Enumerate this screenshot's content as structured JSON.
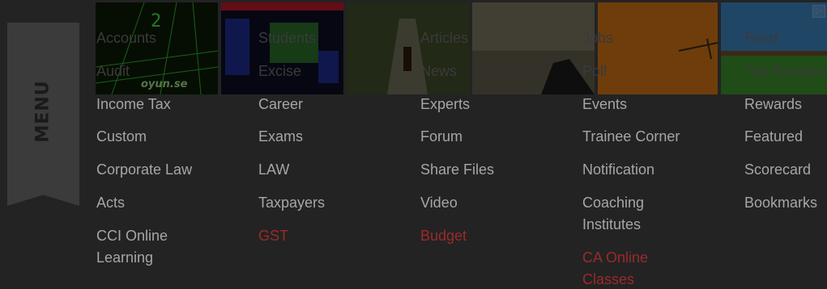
{
  "menu": {
    "label": "MENU"
  },
  "ad": {
    "brand_text": "oyun.se",
    "adchoice_icon": "ad-choices-icon"
  },
  "columns": [
    {
      "items": [
        {
          "label": "Accounts",
          "style": "over"
        },
        {
          "label": "Audit",
          "style": "over"
        },
        {
          "label": "Income Tax",
          "style": "normal"
        },
        {
          "label": "Custom",
          "style": "normal"
        },
        {
          "label": "Corporate Law",
          "style": "normal"
        },
        {
          "label": "Acts",
          "style": "normal"
        },
        {
          "label": "CCI Online Learning",
          "style": "normal"
        }
      ]
    },
    {
      "items": [
        {
          "label": "Students",
          "style": "over"
        },
        {
          "label": "Excise",
          "style": "over"
        },
        {
          "label": "Career",
          "style": "normal"
        },
        {
          "label": "Exams",
          "style": "normal"
        },
        {
          "label": "LAW",
          "style": "normal"
        },
        {
          "label": "Taxpayers",
          "style": "normal"
        },
        {
          "label": "GST",
          "style": "red"
        }
      ]
    },
    {
      "items": [
        {
          "label": "Articles",
          "style": "over"
        },
        {
          "label": "News",
          "style": "over"
        },
        {
          "label": "Experts",
          "style": "normal"
        },
        {
          "label": "Forum",
          "style": "normal"
        },
        {
          "label": "Share Files",
          "style": "normal"
        },
        {
          "label": "Video",
          "style": "normal"
        },
        {
          "label": "Budget",
          "style": "red"
        }
      ]
    },
    {
      "items": [
        {
          "label": "Jobs",
          "style": "over"
        },
        {
          "label": "Poll",
          "style": "over"
        },
        {
          "label": "Events",
          "style": "normal"
        },
        {
          "label": "Trainee Corner",
          "style": "normal"
        },
        {
          "label": "Notification",
          "style": "normal"
        },
        {
          "label": "Coaching Institutes",
          "style": "normal"
        },
        {
          "label": "CA Online Classes",
          "style": "red"
        }
      ]
    },
    {
      "items": [
        {
          "label": "Feed",
          "style": "over"
        },
        {
          "label": "Top Rankers",
          "style": "over"
        },
        {
          "label": "Rewards",
          "style": "normal"
        },
        {
          "label": "Featured",
          "style": "normal"
        },
        {
          "label": "Scorecard",
          "style": "normal"
        },
        {
          "label": "Bookmarks",
          "style": "normal"
        }
      ]
    }
  ]
}
